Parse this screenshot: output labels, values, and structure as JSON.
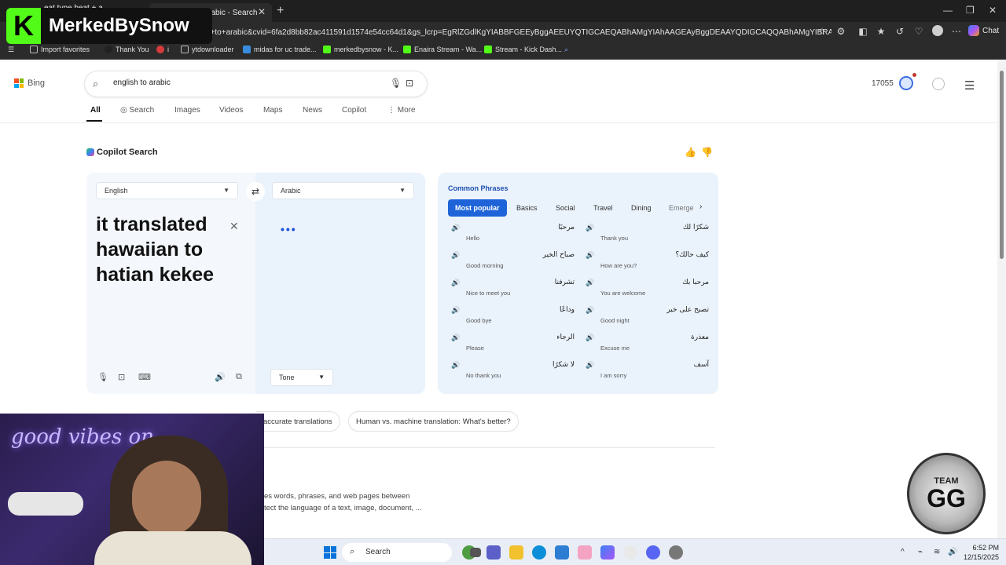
{
  "browser": {
    "tabs": [
      {
        "title": "eat type beat + a dangerous li"
      },
      {
        "title": "english to arabic - Search"
      }
    ],
    "url": "h+to+arabic&cvid=6fa2d8bb82ac411591d1574e54cc64d1&gs_lcrp=EgRlZGdlKgYIABBFGEEyBggAEEUYQTIGCAEQABhAMgYIAhAAGEAyBggDEAAYQDIGCAQQABhAMgYIBRAAGEAyB...",
    "chat_label": "Chat",
    "favorites": [
      {
        "label": "Import favorites"
      },
      {
        "label": "Thank You"
      },
      {
        "label": "i"
      },
      {
        "label": "ytdownloader"
      },
      {
        "label": "midas for uc trade..."
      },
      {
        "label": "merkedbysnow - K..."
      },
      {
        "label": "Enaira Stream - Wa..."
      },
      {
        "label": "Stream - Kick Dash..."
      }
    ]
  },
  "overlay": {
    "streamer_name": "MerkedBySnow",
    "streamer_initial": "K",
    "webcam_sign": "good vibes on",
    "badge_top": "TEAM",
    "badge_main": "GG"
  },
  "bing": {
    "logo_text": "Bing",
    "query": "english to arabic",
    "points": "17055",
    "nav": [
      {
        "label": "All"
      },
      {
        "label": "Search"
      },
      {
        "label": "Images"
      },
      {
        "label": "Videos"
      },
      {
        "label": "Maps"
      },
      {
        "label": "News"
      },
      {
        "label": "Copilot"
      },
      {
        "label": "More"
      }
    ],
    "copilot_title": "Copilot Search"
  },
  "translator": {
    "source_lang": "English",
    "target_lang": "Arabic",
    "source_text": "it translated hawaiian to hatian kekee",
    "loading": "•••",
    "tone_label": "Tone"
  },
  "phrases": {
    "title": "Common Phrases",
    "tabs": [
      {
        "label": "Most popular"
      },
      {
        "label": "Basics"
      },
      {
        "label": "Social"
      },
      {
        "label": "Travel"
      },
      {
        "label": "Dining"
      },
      {
        "label": "Emerge"
      }
    ],
    "items": [
      {
        "ar": "مرحبًا",
        "en": "Hello"
      },
      {
        "ar": "شكرًا لك",
        "en": "Thank you"
      },
      {
        "ar": "صباح الخير",
        "en": "Good morning"
      },
      {
        "ar": "كيف حالك؟",
        "en": "How are you?"
      },
      {
        "ar": "تشرفنا",
        "en": "Nice to meet you"
      },
      {
        "ar": "مرحبا بك",
        "en": "You are welcome"
      },
      {
        "ar": "وداعًا",
        "en": "Good bye"
      },
      {
        "ar": "تصبح على خير",
        "en": "Good night"
      },
      {
        "ar": "الرجاء",
        "en": "Please"
      },
      {
        "ar": "معذرة",
        "en": "Excuse me"
      },
      {
        "ar": "لا شكرًا",
        "en": "No thank you"
      },
      {
        "ar": "آسف",
        "en": "I am sorry"
      }
    ]
  },
  "related": {
    "chips": [
      {
        "label": "accurate translations"
      },
      {
        "label": "Human vs. machine translation: What's better?"
      }
    ],
    "snippet_line1": "es words, phrases, and web pages between",
    "snippet_line2": "tect the language of a text, image, document, ..."
  },
  "taskbar": {
    "search_label": "Search",
    "time": "6:52 PM",
    "date": "12/15/2025"
  }
}
